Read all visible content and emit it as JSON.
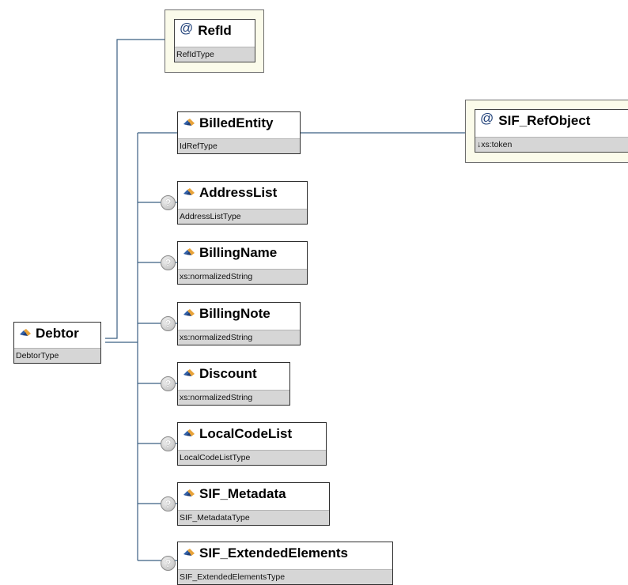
{
  "root": {
    "name": "Debtor",
    "type": "DebtorType",
    "icon": "element-icon"
  },
  "attribute": {
    "name": "RefId",
    "type": "RefIdType",
    "icon": "attribute-at-icon"
  },
  "billed_entity": {
    "name": "BilledEntity",
    "type": "IdRefType",
    "icon": "element-icon"
  },
  "sif_ref_object": {
    "name": "SIF_RefObject",
    "type": "↓xs:token",
    "icon": "attribute-at-icon"
  },
  "children": [
    {
      "name": "AddressList",
      "type": "AddressListType",
      "optional_marker": "?"
    },
    {
      "name": "BillingName",
      "type": "xs:normalizedString",
      "optional_marker": "?"
    },
    {
      "name": "BillingNote",
      "type": "xs:normalizedString",
      "optional_marker": "?"
    },
    {
      "name": "Discount",
      "type": "xs:normalizedString",
      "optional_marker": "?"
    },
    {
      "name": "LocalCodeList",
      "type": "LocalCodeListType",
      "optional_marker": "?"
    },
    {
      "name": "SIF_Metadata",
      "type": "SIF_MetadataType",
      "optional_marker": "?"
    },
    {
      "name": "SIF_ExtendedElements",
      "type": "SIF_ExtendedElementsType",
      "optional_marker": "?"
    }
  ],
  "colors": {
    "connector": "#3b5f82",
    "attribute_bg": "#fbfbea",
    "type_bar": "#d6d6d6",
    "element_icon_blue": "#2f5fa8",
    "element_icon_orange": "#e8a33a"
  }
}
